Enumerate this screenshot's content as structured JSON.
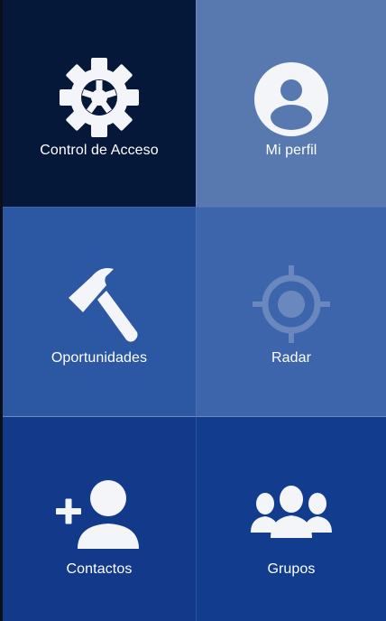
{
  "tiles": {
    "access": {
      "label": "Control de Acceso",
      "icon": "gear-icon"
    },
    "profile": {
      "label": "Mi perfil",
      "icon": "user-circle-icon"
    },
    "opportunities": {
      "label": "Oportunidades",
      "icon": "hammer-icon"
    },
    "radar": {
      "label": "Radar",
      "icon": "crosshair-icon"
    },
    "contacts": {
      "label": "Contactos",
      "icon": "add-user-icon"
    },
    "groups": {
      "label": "Grupos",
      "icon": "group-icon"
    }
  },
  "colors": {
    "access_bg": "#05183a",
    "profile_bg": "#5878b0",
    "opportunities_bg": "#2c57a3",
    "radar_bg": "#3d65ac",
    "contacts_bg": "#12398a",
    "groups_bg": "#123d8e",
    "icon": "#f4f5f8",
    "radar_icon_muted": "#6a88bd"
  }
}
